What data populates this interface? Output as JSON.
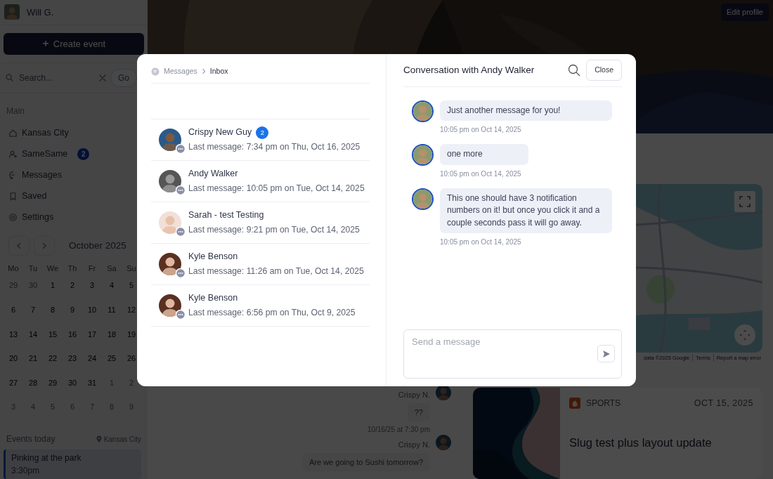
{
  "sidebar": {
    "user": {
      "name": "Will G."
    },
    "create_button": "Create event",
    "search": {
      "placeholder": "Search...",
      "go_button": "Go"
    },
    "section_label": "Main",
    "nav": [
      {
        "label": "Kansas City"
      },
      {
        "label": "SameSame",
        "badge": "2"
      },
      {
        "label": "Messages"
      },
      {
        "label": "Saved"
      },
      {
        "label": "Settings"
      }
    ],
    "calendar": {
      "month": "October 2025",
      "weekdays": [
        "Mo",
        "Tu",
        "We",
        "Th",
        "Fr",
        "Sa",
        "Su"
      ],
      "weeks": [
        [
          {
            "day": "29",
            "muted": true
          },
          {
            "day": "30",
            "muted": true
          },
          {
            "day": "1",
            "muted": false
          },
          {
            "day": "2",
            "muted": false
          },
          {
            "day": "3",
            "muted": false
          },
          {
            "day": "4",
            "muted": false
          },
          {
            "day": "5",
            "muted": false
          }
        ],
        [
          {
            "day": "6",
            "muted": false
          },
          {
            "day": "7",
            "muted": false
          },
          {
            "day": "8",
            "muted": false
          },
          {
            "day": "9",
            "muted": false
          },
          {
            "day": "10",
            "muted": false
          },
          {
            "day": "11",
            "muted": false
          },
          {
            "day": "12",
            "muted": false
          }
        ],
        [
          {
            "day": "13",
            "muted": false
          },
          {
            "day": "14",
            "muted": false
          },
          {
            "day": "15",
            "muted": false
          },
          {
            "day": "16",
            "muted": false
          },
          {
            "day": "17",
            "muted": false
          },
          {
            "day": "18",
            "muted": false
          },
          {
            "day": "19",
            "muted": false
          }
        ],
        [
          {
            "day": "20",
            "muted": false
          },
          {
            "day": "21",
            "muted": false
          },
          {
            "day": "22",
            "muted": false
          },
          {
            "day": "23",
            "muted": false
          },
          {
            "day": "24",
            "muted": false
          },
          {
            "day": "25",
            "muted": false
          },
          {
            "day": "26",
            "muted": false
          }
        ],
        [
          {
            "day": "27",
            "muted": false
          },
          {
            "day": "28",
            "muted": false
          },
          {
            "day": "29",
            "muted": false
          },
          {
            "day": "30",
            "muted": false
          },
          {
            "day": "31",
            "muted": false
          },
          {
            "day": "1",
            "muted": true
          },
          {
            "day": "2",
            "muted": true
          }
        ],
        [
          {
            "day": "3",
            "muted": true
          },
          {
            "day": "4",
            "muted": true
          },
          {
            "day": "5",
            "muted": true
          },
          {
            "day": "6",
            "muted": true
          },
          {
            "day": "7",
            "muted": true
          },
          {
            "day": "8",
            "muted": true
          },
          {
            "day": "9",
            "muted": true
          }
        ]
      ]
    },
    "events_today": {
      "title": "Events today",
      "location": "Kansas City",
      "events": [
        {
          "title": "Pinking at the park",
          "time": "3:30pm"
        }
      ]
    }
  },
  "profile": {
    "edit_button": "Edit profile"
  },
  "map": {
    "attribution": [
      "data ©2025 Google",
      "Terms",
      "Report a map error"
    ]
  },
  "chat": {
    "messages": [
      {
        "sender": "Crispy N.",
        "text": "??",
        "time": "10/16/25 at 7:30 pm"
      },
      {
        "sender": "Crispy N.",
        "text": "Are we going to Sushi tomorrow?"
      }
    ]
  },
  "event_card": {
    "category": "SPORTS",
    "date": "OCT 15, 2025",
    "title": "Slug test plus layout update"
  },
  "modal": {
    "breadcrumb": [
      "Messages",
      "Inbox"
    ],
    "conversations": [
      {
        "name": "Crispy New Guy",
        "badge": "2",
        "last": "Last message: 7:34 pm on Thu, Oct 16, 2025"
      },
      {
        "name": "Andy Walker",
        "last": "Last message: 10:05 pm on Tue, Oct 14, 2025"
      },
      {
        "name": "Sarah - test Testing",
        "last": "Last message: 9:21 pm on Tue, Oct 14, 2025"
      },
      {
        "name": "Kyle Benson",
        "last": "Last message: 11:26 am on Tue, Oct 14, 2025"
      },
      {
        "name": "Kyle Benson",
        "last": "Last message: 6:56 pm on Thu, Oct 9, 2025"
      }
    ],
    "title": "Conversation with Andy Walker",
    "close_button": "Close",
    "messages": [
      {
        "text": "Just another message for you!",
        "time": "10:05 pm on Oct 14, 2025"
      },
      {
        "text": "one more",
        "time": "10:05 pm on Oct 14, 2025"
      },
      {
        "text": "This one should have 3 notification numbers on it! but once you click it and a couple seconds pass it will go away.",
        "time": "10:05 pm on Oct 14, 2025"
      }
    ],
    "composer": {
      "placeholder": "Send a message"
    }
  }
}
